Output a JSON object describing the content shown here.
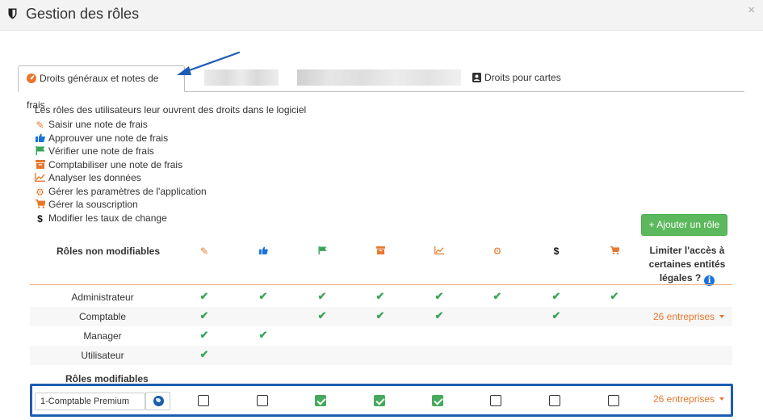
{
  "window": {
    "title": "Gestion des rôles",
    "close_glyph": "×"
  },
  "tabs": [
    {
      "label": "Droits généraux et notes de frais",
      "icon": "tachometer-icon",
      "active": true
    },
    {
      "label": "Droits pour cartes",
      "icon": "contact-card-icon",
      "active": false
    }
  ],
  "intro": "Les rôles des utilisateurs leur ouvrent des droits dans le logiciel",
  "permissions": [
    {
      "label": "Saisir une note de frais",
      "icon": "edit-icon",
      "glyph": "✎",
      "color": "#e8772e"
    },
    {
      "label": "Approuver une note de frais",
      "icon": "thumbs-up-icon",
      "glyph": "👍",
      "color": "#1a73d9"
    },
    {
      "label": "Vérifier une note de frais",
      "icon": "flag-icon",
      "glyph": "⚑",
      "color": "#3aa55a"
    },
    {
      "label": "Comptabiliser une note de frais",
      "icon": "archive-icon",
      "glyph": "▬",
      "color": "#e8772e"
    },
    {
      "label": "Analyser les données",
      "icon": "line-chart-icon",
      "glyph": "↗",
      "color": "#e8772e"
    },
    {
      "label": "Gérer les paramètres de l'application",
      "icon": "gear-icon",
      "glyph": "⚙",
      "color": "#e8772e"
    },
    {
      "label": "Gérer la souscription",
      "icon": "cart-icon",
      "glyph": "🛒",
      "color": "#e8772e"
    },
    {
      "label": "Modifier les taux de change",
      "icon": "dollar-icon",
      "glyph": "$",
      "color": "#111111"
    }
  ],
  "add_role_button": "+ Ajouter un rôle",
  "table": {
    "fixed_title": "Rôles non modifiables",
    "limit_header_lines": [
      "Limiter l'accès à",
      "certaines entités",
      "légales ?"
    ],
    "info_glyph": "i",
    "check_glyph": "✔",
    "fixed_roles": [
      {
        "name": "Administrateur",
        "rights": [
          true,
          true,
          true,
          true,
          true,
          true,
          true,
          true
        ],
        "companies": ""
      },
      {
        "name": "Comptable",
        "rights": [
          true,
          false,
          true,
          true,
          true,
          false,
          true,
          false
        ],
        "companies": "26 entreprises"
      },
      {
        "name": "Manager",
        "rights": [
          true,
          true,
          false,
          false,
          false,
          false,
          false,
          false
        ],
        "companies": ""
      },
      {
        "name": "Utilisateur",
        "rights": [
          true,
          false,
          false,
          false,
          false,
          false,
          false,
          false
        ],
        "companies": ""
      }
    ],
    "editable_title": "Rôles modifiables",
    "editable_roles": [
      {
        "name": "1-Comptable Premium",
        "rights": [
          false,
          false,
          true,
          true,
          true,
          false,
          false,
          false
        ],
        "companies": "26 entreprises"
      }
    ]
  }
}
